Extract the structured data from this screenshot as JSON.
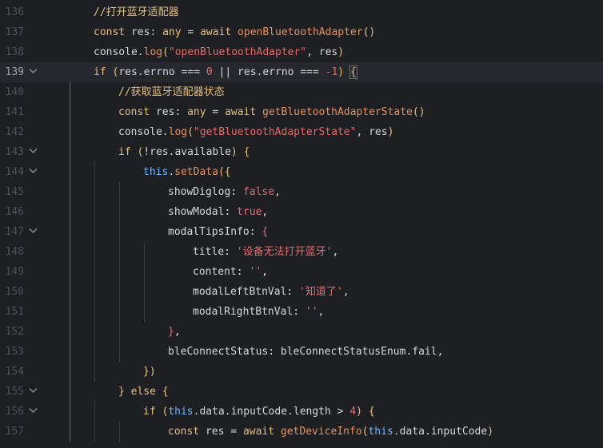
{
  "lines": [
    {
      "num": "136",
      "fold": false,
      "current": false,
      "indent": 2,
      "tokens": [
        [
          "c-cm",
          "//打开蓝牙适配器"
        ]
      ]
    },
    {
      "num": "137",
      "fold": false,
      "current": false,
      "indent": 2,
      "tokens": [
        [
          "c-kw",
          "const "
        ],
        [
          "c-id",
          "res"
        ],
        [
          "c-pn",
          ": "
        ],
        [
          "c-kw",
          "any"
        ],
        [
          "c-pn",
          " = "
        ],
        [
          "c-kw",
          "await "
        ],
        [
          "c-fn",
          "openBluetoothAdapter"
        ],
        [
          "c-kw",
          "()"
        ]
      ]
    },
    {
      "num": "138",
      "fold": false,
      "current": false,
      "indent": 2,
      "tokens": [
        [
          "c-id",
          "console"
        ],
        [
          "c-pn",
          "."
        ],
        [
          "c-fn",
          "log"
        ],
        [
          "c-kw",
          "("
        ],
        [
          "c-str",
          "\"openBluetoothAdapter\""
        ],
        [
          "c-pn",
          ", "
        ],
        [
          "c-id",
          "res"
        ],
        [
          "c-kw",
          ")"
        ]
      ]
    },
    {
      "num": "139",
      "fold": true,
      "current": true,
      "indent": 2,
      "tokens": [
        [
          "c-kw",
          "if "
        ],
        [
          "c-kw",
          "("
        ],
        [
          "c-id",
          "res"
        ],
        [
          "c-pn",
          "."
        ],
        [
          "c-id",
          "errno"
        ],
        [
          "c-pn",
          " === "
        ],
        [
          "c-num",
          "0"
        ],
        [
          "c-pn",
          " || "
        ],
        [
          "c-id",
          "res"
        ],
        [
          "c-pn",
          "."
        ],
        [
          "c-id",
          "errno"
        ],
        [
          "c-pn",
          " === "
        ],
        [
          "c-num",
          "-1"
        ],
        [
          "c-kw",
          ") "
        ],
        [
          "c-kw bracket-hl",
          "{"
        ]
      ]
    },
    {
      "num": "140",
      "fold": false,
      "current": false,
      "indent": 3,
      "tokens": [
        [
          "c-cm",
          "//获取蓝牙适配器状态"
        ]
      ]
    },
    {
      "num": "141",
      "fold": false,
      "current": false,
      "indent": 3,
      "tokens": [
        [
          "c-kw",
          "const "
        ],
        [
          "c-id",
          "res"
        ],
        [
          "c-pn",
          ": "
        ],
        [
          "c-kw",
          "any"
        ],
        [
          "c-pn",
          " = "
        ],
        [
          "c-kw",
          "await "
        ],
        [
          "c-fn",
          "getBluetoothAdapterState"
        ],
        [
          "c-kw",
          "()"
        ]
      ]
    },
    {
      "num": "142",
      "fold": false,
      "current": false,
      "indent": 3,
      "tokens": [
        [
          "c-id",
          "console"
        ],
        [
          "c-pn",
          "."
        ],
        [
          "c-fn",
          "log"
        ],
        [
          "c-kw",
          "("
        ],
        [
          "c-str",
          "\"getBluetoothAdapterState\""
        ],
        [
          "c-pn",
          ", "
        ],
        [
          "c-id",
          "res"
        ],
        [
          "c-kw",
          ")"
        ]
      ]
    },
    {
      "num": "143",
      "fold": true,
      "current": false,
      "indent": 3,
      "tokens": [
        [
          "c-kw",
          "if "
        ],
        [
          "c-kw",
          "("
        ],
        [
          "c-pn",
          "!"
        ],
        [
          "c-id",
          "res"
        ],
        [
          "c-pn",
          "."
        ],
        [
          "c-id",
          "available"
        ],
        [
          "c-kw",
          ") "
        ],
        [
          "c-kw",
          "{"
        ]
      ]
    },
    {
      "num": "144",
      "fold": true,
      "current": false,
      "indent": 4,
      "tokens": [
        [
          "c-this",
          "this"
        ],
        [
          "c-pn",
          "."
        ],
        [
          "c-fn",
          "setData"
        ],
        [
          "c-kw",
          "({"
        ]
      ]
    },
    {
      "num": "145",
      "fold": false,
      "current": false,
      "indent": 5,
      "tokens": [
        [
          "c-id",
          "showDiglog"
        ],
        [
          "c-pn",
          ": "
        ],
        [
          "c-bool",
          "false"
        ],
        [
          "c-pn",
          ","
        ]
      ]
    },
    {
      "num": "146",
      "fold": false,
      "current": false,
      "indent": 5,
      "tokens": [
        [
          "c-id",
          "showModal"
        ],
        [
          "c-pn",
          ": "
        ],
        [
          "c-bool",
          "true"
        ],
        [
          "c-pn",
          ","
        ]
      ]
    },
    {
      "num": "147",
      "fold": true,
      "current": false,
      "indent": 5,
      "tokens": [
        [
          "c-id",
          "modalTipsInfo"
        ],
        [
          "c-pn",
          ": "
        ],
        [
          "c-sq",
          "{"
        ]
      ]
    },
    {
      "num": "148",
      "fold": false,
      "current": false,
      "indent": 6,
      "tokens": [
        [
          "c-id",
          "title"
        ],
        [
          "c-pn",
          ": "
        ],
        [
          "c-str",
          "'设备无法打开蓝牙'"
        ],
        [
          "c-pn",
          ","
        ]
      ]
    },
    {
      "num": "149",
      "fold": false,
      "current": false,
      "indent": 6,
      "tokens": [
        [
          "c-id",
          "content"
        ],
        [
          "c-pn",
          ": "
        ],
        [
          "c-str",
          "''"
        ],
        [
          "c-pn",
          ","
        ]
      ]
    },
    {
      "num": "150",
      "fold": false,
      "current": false,
      "indent": 6,
      "tokens": [
        [
          "c-id",
          "modalLeftBtnVal"
        ],
        [
          "c-pn",
          ": "
        ],
        [
          "c-str",
          "'知道了'"
        ],
        [
          "c-pn",
          ","
        ]
      ]
    },
    {
      "num": "151",
      "fold": false,
      "current": false,
      "indent": 6,
      "tokens": [
        [
          "c-id",
          "modalRightBtnVal"
        ],
        [
          "c-pn",
          ": "
        ],
        [
          "c-str",
          "''"
        ],
        [
          "c-pn",
          ","
        ]
      ]
    },
    {
      "num": "152",
      "fold": false,
      "current": false,
      "indent": 5,
      "tokens": [
        [
          "c-sq",
          "}"
        ],
        [
          "c-pn",
          ","
        ]
      ]
    },
    {
      "num": "153",
      "fold": false,
      "current": false,
      "indent": 5,
      "tokens": [
        [
          "c-id",
          "bleConnectStatus"
        ],
        [
          "c-pn",
          ": "
        ],
        [
          "c-id",
          "bleConnectStatusEnum"
        ],
        [
          "c-pn",
          "."
        ],
        [
          "c-id",
          "fail"
        ],
        [
          "c-pn",
          ","
        ]
      ]
    },
    {
      "num": "154",
      "fold": false,
      "current": false,
      "indent": 4,
      "tokens": [
        [
          "c-kw",
          "})"
        ]
      ]
    },
    {
      "num": "155",
      "fold": true,
      "current": false,
      "indent": 3,
      "tokens": [
        [
          "c-kw",
          "} "
        ],
        [
          "c-kw",
          "else "
        ],
        [
          "c-kw",
          "{"
        ]
      ]
    },
    {
      "num": "156",
      "fold": true,
      "current": false,
      "indent": 4,
      "tokens": [
        [
          "c-kw",
          "if "
        ],
        [
          "c-kw",
          "("
        ],
        [
          "c-this",
          "this"
        ],
        [
          "c-pn",
          "."
        ],
        [
          "c-id",
          "data"
        ],
        [
          "c-pn",
          "."
        ],
        [
          "c-id",
          "inputCode"
        ],
        [
          "c-pn",
          "."
        ],
        [
          "c-id",
          "length"
        ],
        [
          "c-pn",
          " > "
        ],
        [
          "c-num",
          "4"
        ],
        [
          "c-kw",
          ") "
        ],
        [
          "c-kw",
          "{"
        ]
      ]
    },
    {
      "num": "157",
      "fold": false,
      "current": false,
      "indent": 5,
      "tokens": [
        [
          "c-kw",
          "const "
        ],
        [
          "c-id",
          "res"
        ],
        [
          "c-pn",
          " = "
        ],
        [
          "c-kw",
          "await "
        ],
        [
          "c-fn",
          "getDeviceInfo"
        ],
        [
          "c-kw",
          "("
        ],
        [
          "c-this",
          "this"
        ],
        [
          "c-pn",
          "."
        ],
        [
          "c-id",
          "data"
        ],
        [
          "c-pn",
          "."
        ],
        [
          "c-id",
          "inputCode"
        ],
        [
          "c-kw",
          ")"
        ]
      ]
    }
  ]
}
